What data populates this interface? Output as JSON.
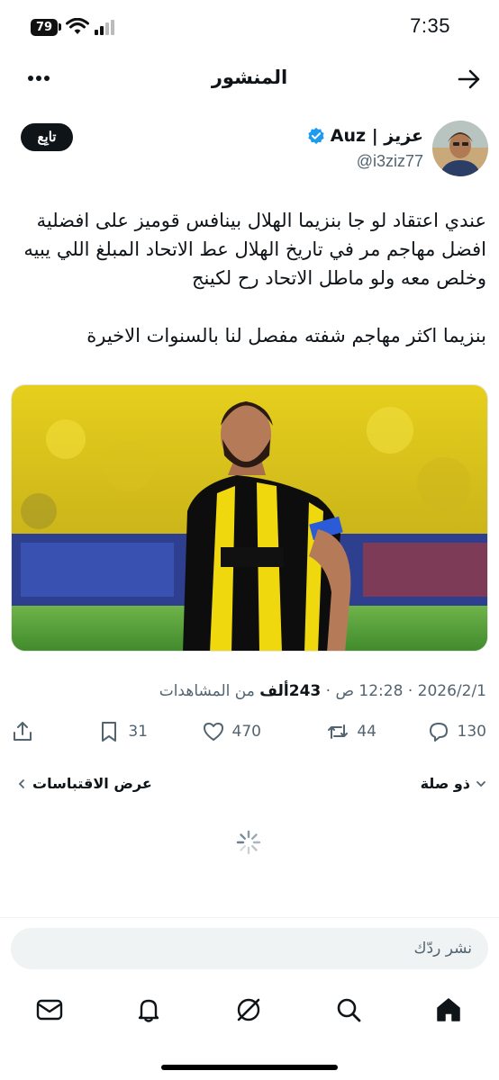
{
  "status_bar": {
    "battery_level": "79",
    "time": "7:35"
  },
  "header": {
    "title": "المنشور"
  },
  "author": {
    "display_name": "عزيز | Auz",
    "handle": "@i3ziz77",
    "verified": true,
    "follow_label": "تابِع"
  },
  "post": {
    "paragraphs": [
      "عندي اعتقاد لو جا بنزيما الهلال بينافس قوميز على افضلية افضل مهاجم مر في تاريخ الهلال عط الاتحاد المبلغ اللي يبيه وخلص معه ولو ماطل الاتحاد رح لكينج",
      "بنزيما اكثر مهاجم شفته مفصل لنا بالسنوات الاخيرة"
    ],
    "date": "2026/2/1",
    "time": "12:28 ص",
    "views_count": "243ألف",
    "views_label": "من المشاهدات",
    "separator": "·"
  },
  "actions": {
    "replies": "130",
    "reposts": "44",
    "likes": "470",
    "bookmarks": "31"
  },
  "related": {
    "connections_label": "ذو صلة",
    "quotes_label": "عرض الاقتباسات"
  },
  "reply": {
    "placeholder": "نشر ردّك"
  },
  "colors": {
    "text": "#0f1419",
    "muted": "#536471",
    "verified": "#1d9bf0",
    "jersey_yellow": "#f5d90a"
  }
}
